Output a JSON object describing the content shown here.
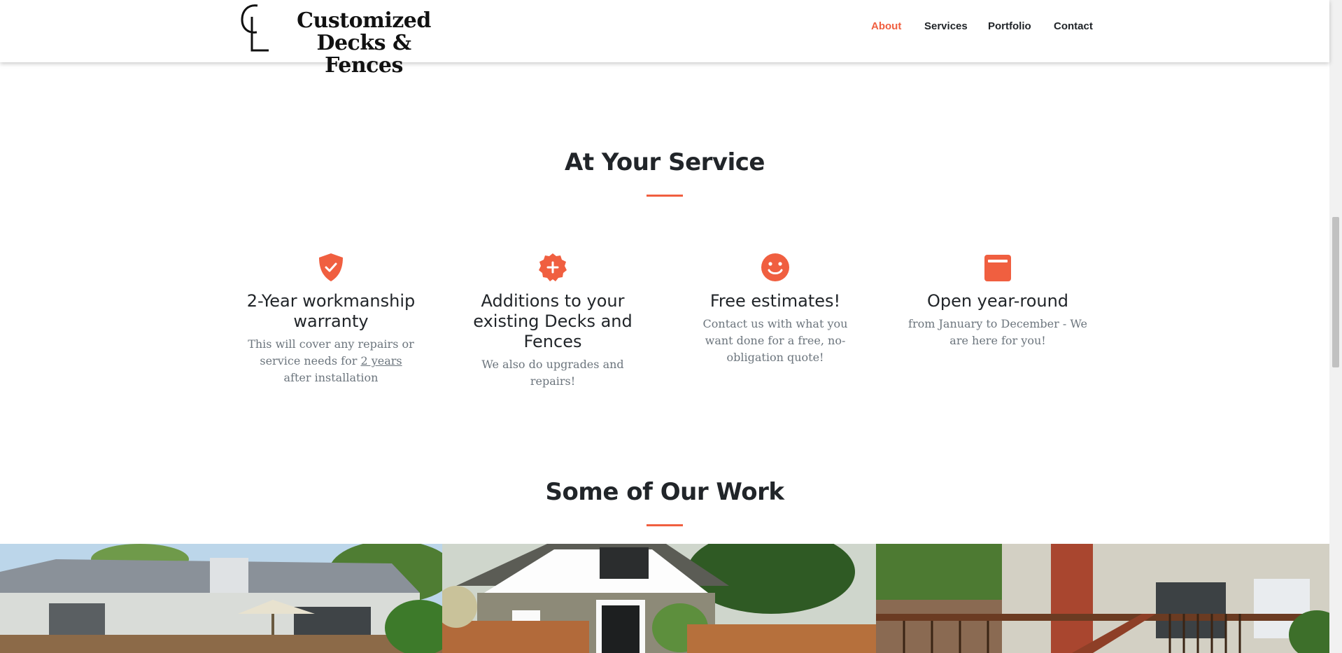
{
  "brand": {
    "monogram": "CL",
    "name_line1": "Customized",
    "name_line2": "Decks & Fences"
  },
  "nav": {
    "items": [
      {
        "label": "About",
        "active": true
      },
      {
        "label": "Services",
        "active": false
      },
      {
        "label": "Portfolio",
        "active": false
      },
      {
        "label": "Contact",
        "active": false
      }
    ]
  },
  "services": {
    "title": "At Your Service",
    "features": [
      {
        "icon": "shield-check-icon",
        "title": "2-Year workmanship warranty",
        "text_before": "This will cover any repairs or service needs for ",
        "text_underlined": "2 years",
        "text_after": " after installation"
      },
      {
        "icon": "badge-plus-icon",
        "title": "Additions to your existing Decks and Fences",
        "text": "We also do upgrades and repairs!"
      },
      {
        "icon": "smile-icon",
        "title": "Free estimates!",
        "text": "Contact us with what you want done for a free, no-obligation quote!"
      },
      {
        "icon": "calendar-icon",
        "title": "Open year-round",
        "text": "from January to December - We are here for you!"
      }
    ]
  },
  "portfolio": {
    "title": "Some of Our Work",
    "photos": [
      "deck-photo-1",
      "deck-photo-2",
      "deck-photo-3"
    ]
  },
  "colors": {
    "accent": "#f05f40",
    "text": "#212529",
    "muted": "#6c757d"
  }
}
